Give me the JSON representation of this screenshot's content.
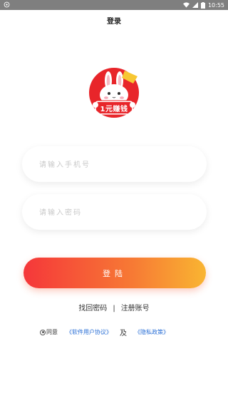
{
  "status_bar": {
    "time": "10:55",
    "icons": [
      "settings-icon",
      "wifi-icon",
      "signal-icon",
      "battery-icon"
    ]
  },
  "page": {
    "title": "登录"
  },
  "logo": {
    "text": "1元赚钱",
    "badge": ""
  },
  "form": {
    "account_placeholder": "请输入手机号",
    "password_placeholder": "请输入密码",
    "login_label": "登陆"
  },
  "links": {
    "find_password": "找回密码",
    "separator": "|",
    "register": "注册账号"
  },
  "agreement": {
    "agree": "同意",
    "user_agreement": "《软件用户协议》",
    "and": "及",
    "privacy_policy": "《隐私政策》"
  },
  "colors": {
    "gradient_start": "#f5373a",
    "gradient_end": "#f9b532",
    "link": "#2a6fd6",
    "status_bar": "#7f7f7f"
  }
}
